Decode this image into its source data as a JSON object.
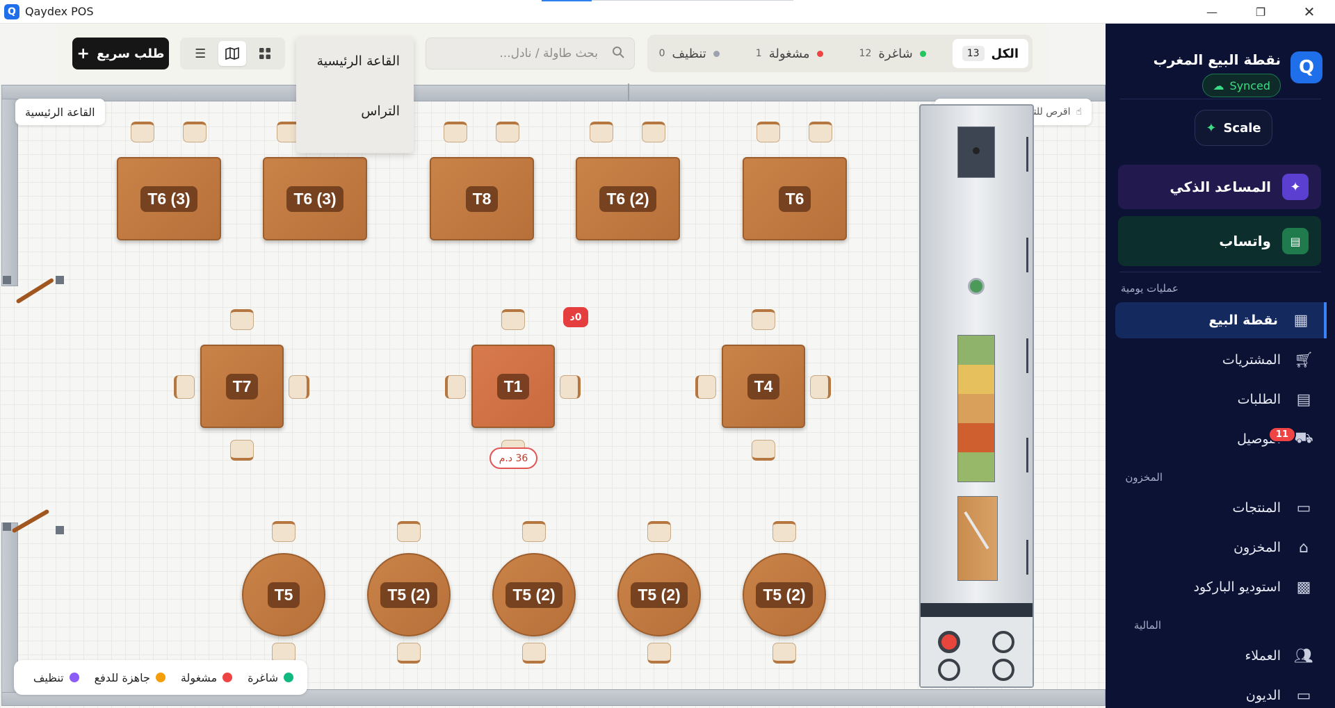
{
  "window": {
    "title": "Qaydex POS",
    "logo_letter": "Q"
  },
  "sidebar": {
    "logo_letter": "Q",
    "store_name": "نقطة البيع المغرب",
    "sync_status": "Synced",
    "scale_label": "Scale",
    "ai_label": "المساعد الذكي",
    "whatsapp_label": "واتساب",
    "sections": {
      "daily": "عمليات يومية",
      "stock": "المخزون",
      "finance": "المالية"
    },
    "items": [
      {
        "label": "نقطة البيع",
        "icon": "cash-register-icon",
        "active": true
      },
      {
        "label": "المشتريات",
        "icon": "cart-icon",
        "active": false
      },
      {
        "label": "الطلبات",
        "icon": "receipt-icon",
        "active": false
      },
      {
        "label": "التوصيل",
        "icon": "truck-icon",
        "active": false,
        "badge": "11"
      },
      {
        "label": "المنتجات",
        "icon": "archive-icon",
        "active": false
      },
      {
        "label": "المخزون",
        "icon": "warehouse-icon",
        "active": false
      },
      {
        "label": "استوديو الباركود",
        "icon": "qr-code-icon",
        "active": false
      },
      {
        "label": "العملاء",
        "icon": "users-icon",
        "active": false
      },
      {
        "label": "الديون",
        "icon": "credit-card-icon",
        "active": false
      }
    ]
  },
  "toolbar": {
    "quick_order": "طلب سريع",
    "search_placeholder": "بحث طاولة / نادل...",
    "rooms": [
      "القاعة الرئيسية",
      "التراس"
    ],
    "filters": [
      {
        "label": "الكل",
        "count": "13",
        "active": true,
        "color": ""
      },
      {
        "label": "شاغرة",
        "count": "12",
        "active": false,
        "color": "#22c55e"
      },
      {
        "label": "مشغولة",
        "count": "1",
        "active": false,
        "color": "#ef4444"
      },
      {
        "label": "تنظيف",
        "count": "0",
        "active": false,
        "color": "#9ca3af"
      }
    ]
  },
  "floor": {
    "room_label": "القاعة الرئيسية",
    "hint": "اقرص للتكبير • اسحب للتنقل",
    "tables": [
      "T6 (3)",
      "T6 (3)",
      "T8",
      "T6 (2)",
      "T6",
      "T7",
      "T1",
      "T4",
      "T5",
      "T5 (2)",
      "T5 (2)",
      "T5 (2)",
      "T5 (2)"
    ],
    "busy_table": "T1",
    "busy_amount": "36 د.م",
    "busy_time": "0د",
    "legend": [
      {
        "label": "شاغرة",
        "color": "#10b981"
      },
      {
        "label": "مشغولة",
        "color": "#ef4444"
      },
      {
        "label": "جاهزة للدفع",
        "color": "#f59e0b"
      },
      {
        "label": "تنظيف",
        "color": "#8b5cf6"
      }
    ]
  }
}
